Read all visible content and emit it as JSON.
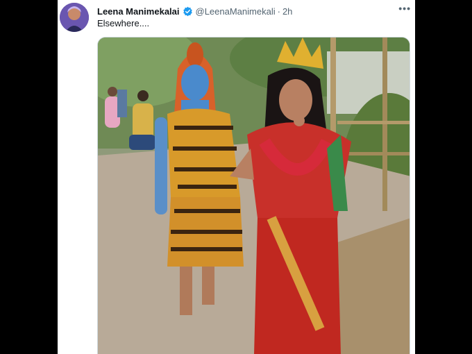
{
  "tweet": {
    "author_name": "Leena Manimekalai",
    "handle": "@LeenaManimekali",
    "separator": "·",
    "time": "2h",
    "more_label": "•••",
    "text": "Elsewhere....",
    "verified": true
  },
  "colors": {
    "background": "#000000",
    "card": "#ffffff",
    "verified_badge": "#1d9bf0",
    "secondary_text": "#536471"
  },
  "icons": [
    "verified-badge-icon",
    "more-options-icon"
  ]
}
